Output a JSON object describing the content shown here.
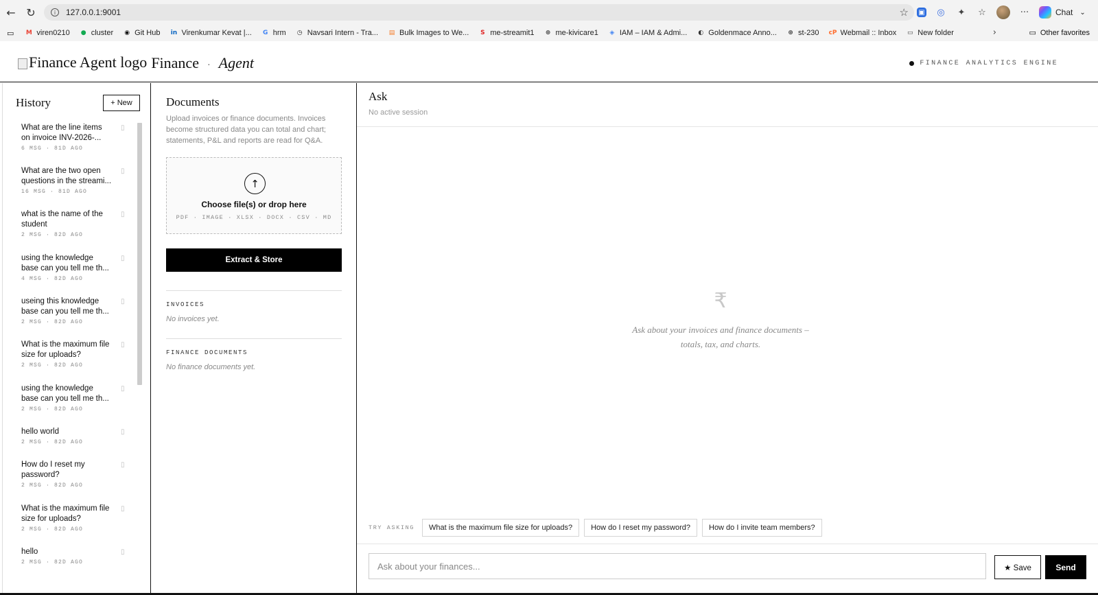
{
  "browser": {
    "url": "127.0.0.1:9001",
    "chat_label": "Chat",
    "bookmarks": [
      {
        "label": "viren0210",
        "icon": "gmail-icon",
        "color": "#ea4335"
      },
      {
        "label": "cluster",
        "icon": "leaf-icon",
        "color": "#13aa52"
      },
      {
        "label": "Git Hub",
        "icon": "github-icon",
        "color": "#111111"
      },
      {
        "label": "Virenkumar Kevat |...",
        "icon": "linkedin-icon",
        "color": "#0a66c2"
      },
      {
        "label": "hrm",
        "icon": "google-icon",
        "color": "#4285f4"
      },
      {
        "label": "Navsari Intern - Tra...",
        "icon": "clock-icon",
        "color": "#333333"
      },
      {
        "label": "Bulk Images to We...",
        "icon": "images-icon",
        "color": "#f47c2a"
      },
      {
        "label": "me-streamit1",
        "icon": "s-icon",
        "color": "#e02424"
      },
      {
        "label": "me-kivicare1",
        "icon": "globe-icon",
        "color": "#444444"
      },
      {
        "label": "IAM – IAM & Admi...",
        "icon": "shield-icon",
        "color": "#4285f4"
      },
      {
        "label": "Goldenmace Anno...",
        "icon": "gm-icon",
        "color": "#333333"
      },
      {
        "label": "st-230",
        "icon": "globe-icon",
        "color": "#444444"
      },
      {
        "label": "Webmail :: Inbox",
        "icon": "cpanel-icon",
        "color": "#ff6c2c"
      },
      {
        "label": "New folder",
        "icon": "folder-icon",
        "color": "#444444"
      }
    ],
    "other_favorites": "Other favorites"
  },
  "header": {
    "logo_alt": "Finance Agent logo",
    "title": "Finance",
    "separator": "·",
    "subtitle": "Agent",
    "engine_label": "FINANCE ANALYTICS ENGINE"
  },
  "history": {
    "title": "History",
    "new_label": "+ New",
    "items": [
      {
        "q1": "What are the line items",
        "q2": "on invoice INV-2026-...",
        "meta": "6 MSG · 81D AGO"
      },
      {
        "q1": "What are the two open",
        "q2": "questions in the streami...",
        "meta": "16 MSG · 81D AGO"
      },
      {
        "q1": "what is the name of the",
        "q2": "student",
        "meta": "2 MSG · 82D AGO"
      },
      {
        "q1": "using the knowledge",
        "q2": "base can you tell me th...",
        "meta": "4 MSG · 82D AGO"
      },
      {
        "q1": "useing this knowledge",
        "q2": "base can you tell me th...",
        "meta": "2 MSG · 82D AGO"
      },
      {
        "q1": "What is the maximum file",
        "q2": "size for uploads?",
        "meta": "2 MSG · 82D AGO"
      },
      {
        "q1": "using the knowledge",
        "q2": "base can you tell me th...",
        "meta": "2 MSG · 82D AGO"
      },
      {
        "q1": "hello world",
        "q2": "",
        "meta": "2 MSG · 82D AGO"
      },
      {
        "q1": "How do I reset my",
        "q2": "password?",
        "meta": "2 MSG · 82D AGO"
      },
      {
        "q1": "What is the maximum file",
        "q2": "size for uploads?",
        "meta": "2 MSG · 82D AGO"
      },
      {
        "q1": "hello",
        "q2": "",
        "meta": "2 MSG · 82D AGO"
      }
    ]
  },
  "documents": {
    "title": "Documents",
    "description": "Upload invoices or finance documents. Invoices become structured data you can total and chart; statements, P&L and reports are read for Q&A.",
    "dropzone_title": "Choose file(s) or drop here",
    "dropzone_types": "PDF · IMAGE · XLSX · DOCX · CSV · MD",
    "extract_label": "Extract & Store",
    "invoices_label": "INVOICES",
    "invoices_empty": "No invoices yet.",
    "finance_label": "FINANCE DOCUMENTS",
    "finance_empty": "No finance documents yet."
  },
  "ask": {
    "title": "Ask",
    "session": "No active session",
    "empty_symbol": "₹",
    "empty_line1": "Ask about your invoices and finance documents –",
    "empty_line2": "totals, tax, and charts.",
    "try_label": "TRY ASKING",
    "suggestions": [
      "What is the maximum file size for uploads?",
      "How do I reset my password?",
      "How do I invite team members?"
    ],
    "input_placeholder": "Ask about your finances...",
    "save_label": "★ Save",
    "send_label": "Send"
  }
}
